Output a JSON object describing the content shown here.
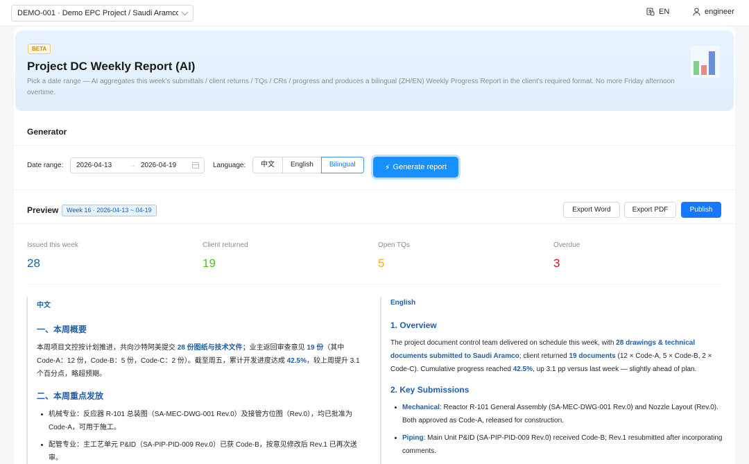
{
  "topbar": {
    "project": "DEMO-001 · Demo EPC Project / Saudi Aramco ...",
    "language": "EN",
    "user": "engineer"
  },
  "hero": {
    "badge": "BETA",
    "title": "Project DC Weekly Report (AI)",
    "description": "Pick a date range — AI aggregates this week's submittals / client returns / TQs / CRs / progress and produces a bilingual (ZH/EN) Weekly Progress Report in the client's required format. No more Friday afternoon overtime."
  },
  "generator": {
    "title": "Generator",
    "date_range_label": "Date range",
    "start_date": "2026-04-13",
    "end_date": "2026-04-19",
    "language_label": "Language",
    "language_options": [
      "中文",
      "English",
      "Bilingual"
    ],
    "selected_language": "Bilingual",
    "generate_label": "Generate report"
  },
  "preview": {
    "title": "Preview",
    "week_tag": "Week 16 · 2026-04-13 ~ 04-19",
    "export_word": "Export Word",
    "export_pdf": "Export PDF",
    "publish": "Publish"
  },
  "stats": [
    {
      "label": "Issued this week",
      "value": "28",
      "color": "#1d5fa0"
    },
    {
      "label": "Client returned",
      "value": "19",
      "color": "#52c41a"
    },
    {
      "label": "Open TQs",
      "value": "5",
      "color": "#faad14"
    },
    {
      "label": "Overdue",
      "value": "3",
      "color": "#cf1322"
    }
  ],
  "zh": {
    "label": "中文",
    "h1": "一、本周概要",
    "p1_a": "本周项目文控按计划推进，共向沙特阿美提交 ",
    "p1_b": "28 份图纸与技术文件",
    "p1_c": "；业主返回审查意见 ",
    "p1_d": "19 份",
    "p1_e": "（其中 Code-A：12 份，Code-B：5 份，Code-C：2 份）。截至周五，累计开发进度达成 ",
    "p1_f": "42.5%",
    "p1_g": "，较上周提升 3.1 个百分点，略超预期。",
    "h2": "二、本周重点发放",
    "item1": "机械专业：反应器 R-101 总装图（SA-MEC-DWG-001 Rev.0）及接管方位图（Rev.0），均已批准为 Code-A，可用于施工。",
    "item2": "配管专业：主工艺单元 P&ID（SA-PIP-PID-009 Rev.0）已获 Code-B，按意见修改后 Rev.1 已再次送审。"
  },
  "en": {
    "label": "English",
    "h1": "1. Overview",
    "p1_a": "The project document control team delivered on schedule this week, with ",
    "p1_b": "28 drawings & technical documents submitted to Saudi Aramco",
    "p1_c": "; client returned ",
    "p1_d": "19 documents",
    "p1_e": " (12 × Code-A, 5 × Code-B, 2 × Code-C). Cumulative progress reached ",
    "p1_f": "42.5%",
    "p1_g": ", up 3.1 pp versus last week — slightly ahead of plan.",
    "h2": "2. Key Submissions",
    "item1_key": "Mechanical",
    "item1": ": Reactor R-101 General Assembly (SA-MEC-DWG-001 Rev.0) and Nozzle Layout (Rev.0). Both approved as Code-A, released for construction.",
    "item2_key": "Piping",
    "item2": ": Main Unit P&ID (SA-PIP-PID-009 Rev.0) received Code-B; Rev.1 resubmitted after incorporating comments."
  }
}
